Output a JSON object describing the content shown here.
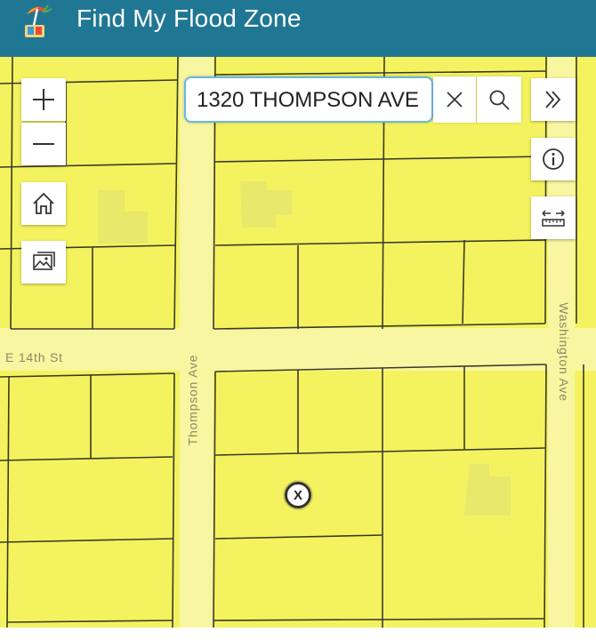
{
  "header": {
    "title": "Find My Flood Zone",
    "logo_icon": "beach-umbrella-logo-icon",
    "background": "#1f7793"
  },
  "map": {
    "fill_color": "#f4f35f",
    "road_color": "#f8f6a0",
    "road_labels": {
      "e14th": "E 14th St",
      "thompson": "Thompson Ave",
      "washington": "Washington Ave"
    },
    "marker_label": "X"
  },
  "search": {
    "value": "1320 THOMPSON AVE",
    "clear_icon": "close-icon",
    "search_icon": "search-icon"
  },
  "controls": {
    "zoom_in": "plus-icon",
    "zoom_out": "minus-icon",
    "home": "home-icon",
    "basemap": "image-gallery-icon",
    "expand": "double-chevron-right-icon",
    "info": "info-icon",
    "measure": "ruler-icon"
  },
  "footer": {
    "partial_text": ""
  }
}
